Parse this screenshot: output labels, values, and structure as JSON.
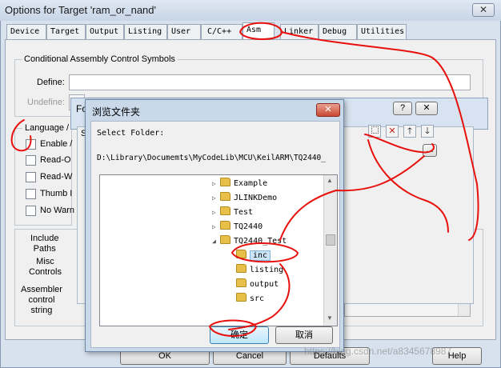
{
  "window": {
    "title": "Options for Target 'ram_or_nand'",
    "close_glyph": "✕"
  },
  "tabs": [
    "Device",
    "Target",
    "Output",
    "Listing",
    "User",
    "C/C++",
    "Asm",
    "Linker",
    "Debug",
    "Utilities"
  ],
  "active_tab": "Asm",
  "conditional": {
    "group_title": "Conditional Assembly Control Symbols",
    "define_label": "Define:",
    "undefine_label": "Undefine:",
    "define_value": "",
    "undefine_value": ""
  },
  "language": {
    "group_title": "Language /",
    "checkboxes": [
      "Enable /",
      "Read-O",
      "Read-W",
      "Thumb I",
      "No Warn"
    ]
  },
  "include": {
    "include_paths_label": "Include\nPaths",
    "misc_controls_label": "Misc\nControls",
    "assembler_label": "Assembler\ncontrol\nstring",
    "browse_button": "..."
  },
  "bottom_buttons": [
    "OK",
    "Cancel",
    "Defaults",
    "Help"
  ],
  "behind_dialog": {
    "title_fragment": "Fo",
    "help_glyph": "?",
    "close_glyph": "✕",
    "sel_fragment": "Se"
  },
  "browse_dialog": {
    "title": "浏览文件夹",
    "select_folder_label": "Select Folder:",
    "path_value": "D:\\Library\\Documemts\\MyCodeLib\\MCU\\KeilARM\\TQ2440_",
    "toolbar_icons": [
      "new-folder-icon",
      "delete-icon",
      "move-up-icon",
      "move-down-icon"
    ],
    "path_browse": "...",
    "tree": [
      {
        "label": "Example",
        "indent": 0,
        "arrow": "▷"
      },
      {
        "label": "JLINKDemo",
        "indent": 0,
        "arrow": "▷"
      },
      {
        "label": "Test",
        "indent": 0,
        "arrow": "▷"
      },
      {
        "label": "TQ2440",
        "indent": 0,
        "arrow": "▷"
      },
      {
        "label": "TQ2440_Test",
        "indent": 0,
        "arrow": "◢"
      },
      {
        "label": "inc",
        "indent": 1,
        "arrow": "",
        "selected": true
      },
      {
        "label": "listing",
        "indent": 1,
        "arrow": ""
      },
      {
        "label": "output",
        "indent": 1,
        "arrow": ""
      },
      {
        "label": "src",
        "indent": 1,
        "arrow": ""
      }
    ],
    "ok_button": "确定",
    "cancel_button": "取消"
  },
  "watermark": "https://blog.csdn.net/a8345678987",
  "colors": {
    "annotation": "#e8100c",
    "selection": "#cce4f7",
    "folder": "#e7bf49"
  }
}
